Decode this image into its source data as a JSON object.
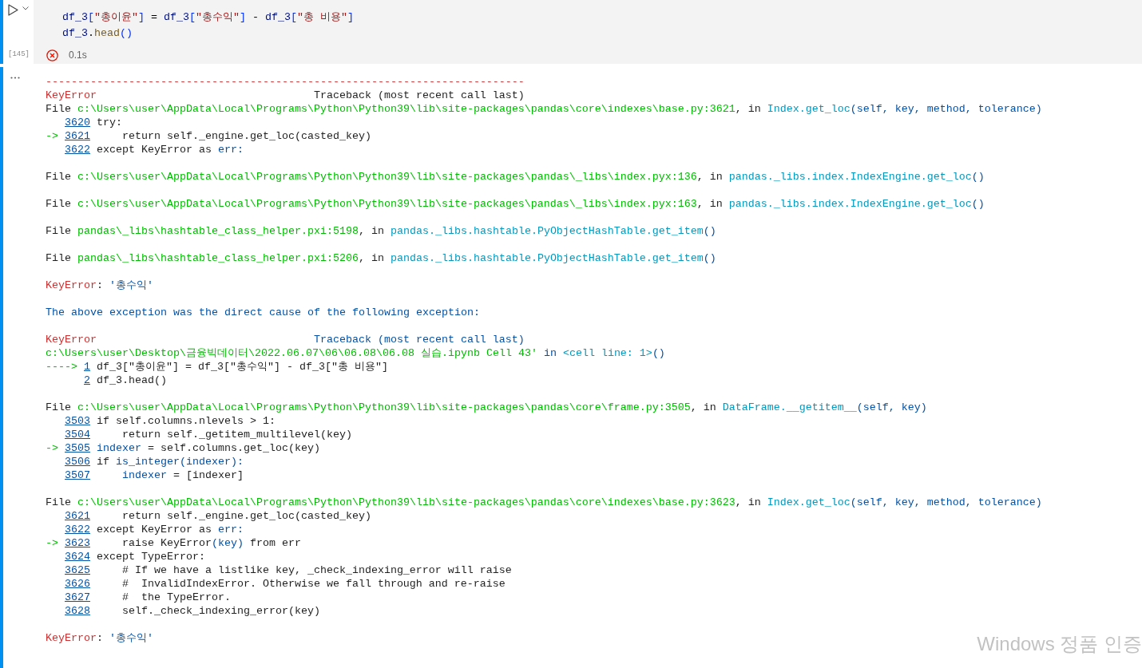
{
  "cell": {
    "code": [
      [
        {
          "text": "df_3",
          "kind": "var"
        },
        {
          "text": "[",
          "kind": "bracket"
        },
        {
          "text": "\"총이윤\"",
          "kind": "string"
        },
        {
          "text": "]",
          "kind": "bracket"
        },
        {
          "text": " = ",
          "kind": "plain"
        },
        {
          "text": "df_3",
          "kind": "var"
        },
        {
          "text": "[",
          "kind": "bracket"
        },
        {
          "text": "\"총수익\"",
          "kind": "string"
        },
        {
          "text": "]",
          "kind": "bracket"
        },
        {
          "text": " - ",
          "kind": "plain"
        },
        {
          "text": "df_3",
          "kind": "var"
        },
        {
          "text": "[",
          "kind": "bracket"
        },
        {
          "text": "\"총 비용\"",
          "kind": "string"
        },
        {
          "text": "]",
          "kind": "bracket"
        }
      ],
      [
        {
          "text": "df_3",
          "kind": "var"
        },
        {
          "text": ".",
          "kind": "plain"
        },
        {
          "text": "head",
          "kind": "func"
        },
        {
          "text": "()",
          "kind": "bracket"
        }
      ]
    ],
    "execution_count": "[145]",
    "status": {
      "kind": "error",
      "duration": "0.1s"
    }
  },
  "output": {
    "blocks": [
      [
        {
          "kind": "rule",
          "text": "---------------------------------------------------------------------------"
        },
        {
          "kind": "header",
          "error": "KeyError",
          "heading": {
            "text": "Traceback (most recent call last)",
            "kind": "plain"
          }
        },
        {
          "kind": "file",
          "spans": [
            {
              "text": "File ",
              "kind": "plain"
            },
            {
              "text": "c:\\Users\\user\\AppData\\Local\\Programs\\Python\\Python39\\lib\\site-packages\\pandas\\core\\indexes\\base.py:3621",
              "kind": "path"
            },
            {
              "text": ", in ",
              "kind": "plain"
            },
            {
              "text": "Index.get_loc",
              "kind": "func"
            },
            {
              "text": "(self, key, method, tolerance)",
              "kind": "name"
            }
          ]
        },
        {
          "kind": "source",
          "lineno": "3620",
          "spans": [
            {
              "text": "try:",
              "kind": "plain"
            }
          ]
        },
        {
          "kind": "source",
          "marker": "->",
          "lineno": "3621",
          "spans": [
            {
              "text": "    return self._engine.get_loc(casted_key)",
              "kind": "plain"
            }
          ]
        },
        {
          "kind": "source",
          "lineno": "3622",
          "spans": [
            {
              "text": "except KeyError as ",
              "kind": "plain"
            },
            {
              "text": "err:",
              "kind": "name"
            }
          ]
        }
      ],
      [
        {
          "kind": "file",
          "spans": [
            {
              "text": "File ",
              "kind": "plain"
            },
            {
              "text": "c:\\Users\\user\\AppData\\Local\\Programs\\Python\\Python39\\lib\\site-packages\\pandas\\_libs\\index.pyx:136",
              "kind": "path"
            },
            {
              "text": ", in ",
              "kind": "plain"
            },
            {
              "text": "pandas._libs.index.IndexEngine.get_loc",
              "kind": "func"
            },
            {
              "text": "()",
              "kind": "name"
            }
          ]
        }
      ],
      [
        {
          "kind": "file",
          "spans": [
            {
              "text": "File ",
              "kind": "plain"
            },
            {
              "text": "c:\\Users\\user\\AppData\\Local\\Programs\\Python\\Python39\\lib\\site-packages\\pandas\\_libs\\index.pyx:163",
              "kind": "path"
            },
            {
              "text": ", in ",
              "kind": "plain"
            },
            {
              "text": "pandas._libs.index.IndexEngine.get_loc",
              "kind": "func"
            },
            {
              "text": "()",
              "kind": "name"
            }
          ]
        }
      ],
      [
        {
          "kind": "file",
          "spans": [
            {
              "text": "File ",
              "kind": "plain"
            },
            {
              "text": "pandas\\_libs\\hashtable_class_helper.pxi:5198",
              "kind": "path"
            },
            {
              "text": ", in ",
              "kind": "plain"
            },
            {
              "text": "pandas._libs.hashtable.PyObjectHashTable.get_item",
              "kind": "func"
            },
            {
              "text": "()",
              "kind": "name"
            }
          ]
        }
      ],
      [
        {
          "kind": "file",
          "spans": [
            {
              "text": "File ",
              "kind": "plain"
            },
            {
              "text": "pandas\\_libs\\hashtable_class_helper.pxi:5206",
              "kind": "path"
            },
            {
              "text": ", in ",
              "kind": "plain"
            },
            {
              "text": "pandas._libs.hashtable.PyObjectHashTable.get_item",
              "kind": "func"
            },
            {
              "text": "()",
              "kind": "name"
            }
          ]
        }
      ],
      [
        {
          "kind": "error",
          "spans": [
            {
              "text": "KeyError",
              "kind": "error"
            },
            {
              "text": ": ",
              "kind": "plain"
            },
            {
              "text": "'총수익'",
              "kind": "name"
            }
          ]
        }
      ],
      [
        {
          "kind": "note",
          "spans": [
            {
              "text": "The above exception was the direct cause of the following exception:",
              "kind": "name"
            }
          ]
        }
      ],
      [
        {
          "kind": "header",
          "error": "KeyError",
          "heading": {
            "text": "Traceback (most recent call last)",
            "kind": "name"
          }
        },
        {
          "kind": "location",
          "spans": [
            {
              "text": "c:\\Users\\user\\Desktop\\금융빅데이터\\2022.06.07\\06\\06.08\\06.08 실습.ipynb Cell 43'",
              "kind": "path"
            },
            {
              "text": " in ",
              "kind": "name"
            },
            {
              "text": "<cell line: 1>",
              "kind": "func"
            },
            {
              "text": "()",
              "kind": "name"
            }
          ]
        },
        {
          "kind": "source",
          "marker": "---->",
          "lineno": "1",
          "spans": [
            {
              "text": "df_3[\"총이윤\"] = df_3[\"총수익\"] - df_3[\"총 비용\"]",
              "kind": "plain"
            }
          ]
        },
        {
          "kind": "source",
          "lineno": "2",
          "spans": [
            {
              "text": "df_3.head()",
              "kind": "plain"
            }
          ]
        }
      ],
      [
        {
          "kind": "file",
          "spans": [
            {
              "text": "File ",
              "kind": "plain"
            },
            {
              "text": "c:\\Users\\user\\AppData\\Local\\Programs\\Python\\Python39\\lib\\site-packages\\pandas\\core\\frame.py:3505",
              "kind": "path"
            },
            {
              "text": ", in ",
              "kind": "plain"
            },
            {
              "text": "DataFrame.__getitem__",
              "kind": "func"
            },
            {
              "text": "(self, key)",
              "kind": "name"
            }
          ]
        },
        {
          "kind": "source",
          "lineno": "3503",
          "spans": [
            {
              "text": "if self.columns.nlevels > 1:",
              "kind": "plain"
            }
          ]
        },
        {
          "kind": "source",
          "lineno": "3504",
          "spans": [
            {
              "text": "    return self._getitem_multilevel(key)",
              "kind": "plain"
            }
          ]
        },
        {
          "kind": "source",
          "marker": "->",
          "lineno": "3505",
          "spans": [
            {
              "text": "indexer",
              "kind": "name"
            },
            {
              "text": " = self.columns.get_loc(key)",
              "kind": "plain"
            }
          ]
        },
        {
          "kind": "source",
          "lineno": "3506",
          "spans": [
            {
              "text": "if ",
              "kind": "plain"
            },
            {
              "text": "is_integer(indexer):",
              "kind": "name"
            }
          ]
        },
        {
          "kind": "source",
          "lineno": "3507",
          "spans": [
            {
              "text": "    indexer",
              "kind": "name"
            },
            {
              "text": " = [indexer]",
              "kind": "plain"
            }
          ]
        }
      ],
      [
        {
          "kind": "file",
          "spans": [
            {
              "text": "File ",
              "kind": "plain"
            },
            {
              "text": "c:\\Users\\user\\AppData\\Local\\Programs\\Python\\Python39\\lib\\site-packages\\pandas\\core\\indexes\\base.py:3623",
              "kind": "path"
            },
            {
              "text": ", in ",
              "kind": "plain"
            },
            {
              "text": "Index.get_loc",
              "kind": "func"
            },
            {
              "text": "(self, key, method, tolerance)",
              "kind": "name"
            }
          ]
        },
        {
          "kind": "source",
          "lineno": "3621",
          "spans": [
            {
              "text": "    return self._engine.get_loc(casted_key)",
              "kind": "plain"
            }
          ]
        },
        {
          "kind": "source",
          "lineno": "3622",
          "spans": [
            {
              "text": "except KeyError as ",
              "kind": "plain"
            },
            {
              "text": "err:",
              "kind": "name"
            }
          ]
        },
        {
          "kind": "source",
          "marker": "->",
          "lineno": "3623",
          "spans": [
            {
              "text": "    raise KeyError",
              "kind": "plain"
            },
            {
              "text": "(key)",
              "kind": "name"
            },
            {
              "text": " from err",
              "kind": "plain"
            }
          ]
        },
        {
          "kind": "source",
          "lineno": "3624",
          "spans": [
            {
              "text": "except TypeError:",
              "kind": "plain"
            }
          ]
        },
        {
          "kind": "source",
          "lineno": "3625",
          "spans": [
            {
              "text": "    # If we have a listlike key, _check_indexing_error will raise",
              "kind": "plain"
            }
          ]
        },
        {
          "kind": "source",
          "lineno": "3626",
          "spans": [
            {
              "text": "    #  InvalidIndexError. Otherwise we fall through and re-raise",
              "kind": "plain"
            }
          ]
        },
        {
          "kind": "source",
          "lineno": "3627",
          "spans": [
            {
              "text": "    #  the TypeError.",
              "kind": "plain"
            }
          ]
        },
        {
          "kind": "source",
          "lineno": "3628",
          "spans": [
            {
              "text": "    self._check_indexing_error(key)",
              "kind": "plain"
            }
          ]
        }
      ],
      [
        {
          "kind": "error",
          "spans": [
            {
              "text": "KeyError",
              "kind": "error"
            },
            {
              "text": ": ",
              "kind": "plain"
            },
            {
              "text": "'총수익'",
              "kind": "name"
            }
          ]
        }
      ]
    ]
  },
  "activation_notice": "Windows 정품 인증"
}
